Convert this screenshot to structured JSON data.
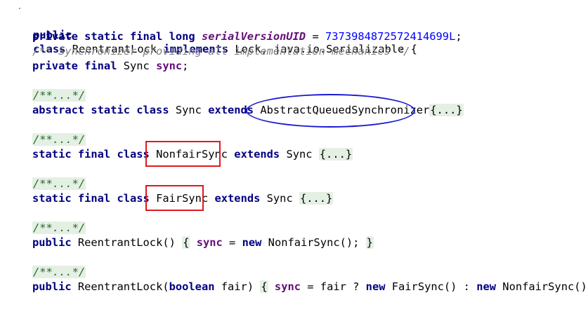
{
  "code": {
    "class_decl": {
      "kw_public": "public",
      "kw_class": "class",
      "name": "ReentrantLock",
      "kw_implements": "implements",
      "interfaces": "Lock, java.io.Serializable {"
    },
    "serial": {
      "kw": "private static final long",
      "field": "serialVersionUID",
      "eq": " = ",
      "value": "7373984872572414699L",
      "semi": ";"
    },
    "doc_comment": "/** Synchronizer providing all implementation mechanics */",
    "sync_field": {
      "kw": "private final",
      "type": " Sync ",
      "name": "sync",
      "semi": ";"
    },
    "fold_comment": "/**...*/",
    "sync_class": {
      "kw": "abstract static class",
      "name": " Sync ",
      "kw_extends": "extends",
      "sp": " ",
      "parent": "AbstractQueuedSynchronizer",
      "fold": "{...}"
    },
    "nonfair_class": {
      "kw": "static final class",
      "sp": " ",
      "name": "NonfairSync",
      "kw_extends": "extends",
      "parent": " Sync ",
      "fold": "{...}"
    },
    "fair_class": {
      "kw": "static final class",
      "sp": " ",
      "name": "FairSync",
      "kw_extends": "extends",
      "parent": " Sync ",
      "fold": "{...}"
    },
    "ctor1": {
      "kw": "public",
      "sig": " ReentrantLock() ",
      "open": "{",
      "field": "sync",
      "eq": " = ",
      "kw_new": "new",
      "rest": " NonfairSync(); ",
      "close": "}"
    },
    "ctor2": {
      "kw": "public",
      "sig1": " ReentrantLock(",
      "kw_bool": "boolean",
      "sig2": " fair) ",
      "open": "{",
      "field": "sync",
      "mid": " = fair ? ",
      "kw_new1": "new",
      "mid2": " FairSync() : ",
      "kw_new2": "new",
      "rest": " NonfairSync(); ",
      "close": "}"
    }
  },
  "colors": {
    "keyword": "#000080",
    "field": "#660e7a",
    "number": "#0000ff",
    "comment": "#808080",
    "highlight_red": "#e0171f",
    "highlight_blue": "#1a1ad0"
  }
}
